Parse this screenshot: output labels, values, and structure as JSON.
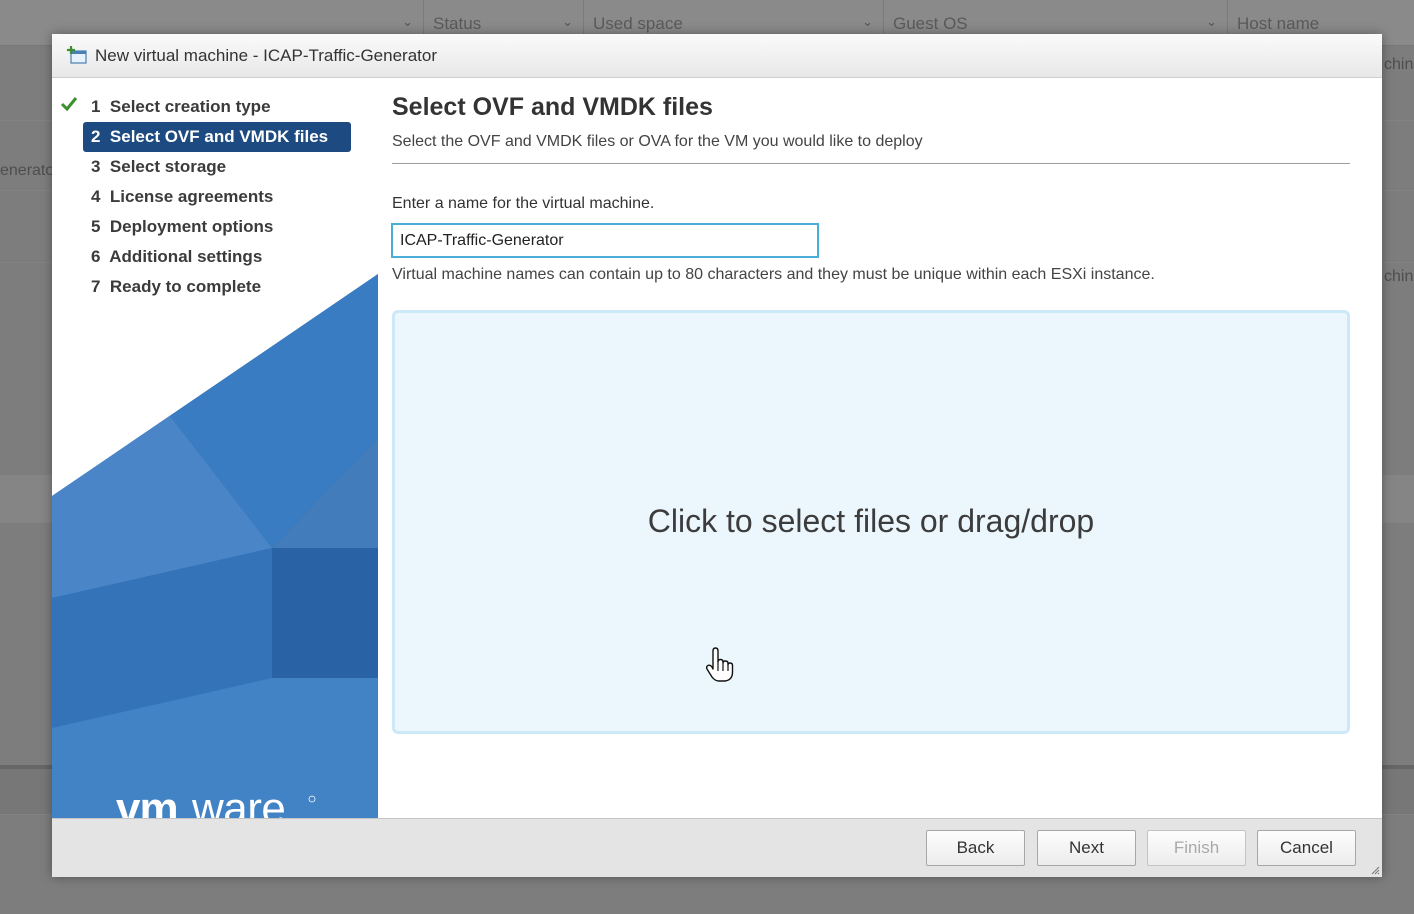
{
  "background": {
    "columns": [
      {
        "label": ""
      },
      {
        "label": "Status"
      },
      {
        "label": "Used space"
      },
      {
        "label": "Guest OS"
      },
      {
        "label": "Host name"
      }
    ],
    "edge_texts": {
      "left_fragment": "enerato",
      "right_fragment_1": "chin",
      "right_fragment_2": "chin"
    }
  },
  "dialog": {
    "title": "New virtual machine - ICAP-Traffic-Generator",
    "title_icon": "new-vm-icon",
    "steps": [
      {
        "label": "1  Select creation type",
        "state": "completed"
      },
      {
        "label": "2  Select OVF and VMDK files",
        "state": "active"
      },
      {
        "label": "3  Select storage",
        "state": "pending"
      },
      {
        "label": "4  License agreements",
        "state": "pending"
      },
      {
        "label": "5  Deployment options",
        "state": "pending"
      },
      {
        "label": "6  Additional settings",
        "state": "pending"
      },
      {
        "label": "7  Ready to complete",
        "state": "pending"
      }
    ],
    "logo": "vmware",
    "heading": "Select OVF and VMDK files",
    "subtitle": "Select the OVF and VMDK files or OVA for the VM you would like to deploy",
    "name_label": "Enter a name for the virtual machine.",
    "name_value": "ICAP-Traffic-Generator",
    "name_hint": "Virtual machine names can contain up to 80 characters and they must be unique within each ESXi instance.",
    "dropzone_text": "Click to select files or drag/drop",
    "buttons": {
      "back": "Back",
      "next": "Next",
      "finish": "Finish",
      "cancel": "Cancel"
    }
  },
  "colors": {
    "active_step_bg": "#1d4a80",
    "check_green": "#3c8f2e",
    "input_border": "#49afd9",
    "dropzone_bg": "#ecf6fd",
    "sidebar_blue": "#2f6fb8"
  }
}
